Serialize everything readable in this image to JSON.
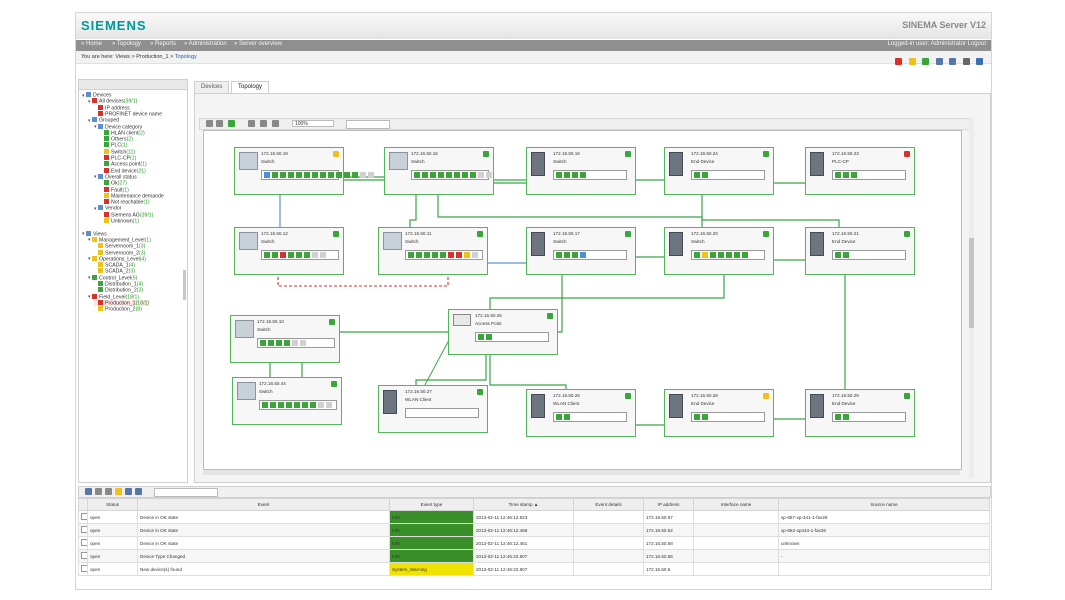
{
  "header": {
    "logo": "SIEMENS",
    "product": "SINEMA Server V12"
  },
  "nav": {
    "items": [
      "» Home",
      "» Topology",
      "» Reports",
      "» Administration",
      "» Server overview"
    ],
    "login": "Logged-in user: Administrator  Logout"
  },
  "breadcrumb": {
    "prefix": "You are here:  Views > Production_1 > ",
    "current": "Topology"
  },
  "colors": {
    "ok": "#3aa63a",
    "fault": "#d9302c",
    "warn": "#efc21b",
    "unknown": "#aaaaaa",
    "link": "#3ca34a"
  },
  "tree": [
    {
      "label": "Devices",
      "count": "",
      "level": 0,
      "icon": "folder",
      "toggle": "▾"
    },
    {
      "label": "All devices",
      "count": "(39/1)",
      "level": 1,
      "icon": "fault",
      "toggle": "▾"
    },
    {
      "label": "IP address",
      "count": "",
      "level": 2,
      "icon": "fault",
      "toggle": ""
    },
    {
      "label": "PROFINET device name",
      "count": "",
      "level": 2,
      "icon": "fault",
      "toggle": ""
    },
    {
      "label": "Grouped",
      "count": "",
      "level": 1,
      "icon": "folder",
      "toggle": "▾"
    },
    {
      "label": "Device category",
      "count": "",
      "level": 2,
      "icon": "folder",
      "toggle": "▾"
    },
    {
      "label": "HLAN client",
      "count": "(2)",
      "level": 3,
      "icon": "ok",
      "toggle": ""
    },
    {
      "label": "Others",
      "count": "(2)",
      "level": 3,
      "icon": "ok",
      "toggle": ""
    },
    {
      "label": "PLC",
      "count": "(1)",
      "level": 3,
      "icon": "ok",
      "toggle": ""
    },
    {
      "label": "Switch",
      "count": "(11)",
      "level": 3,
      "icon": "warn",
      "toggle": ""
    },
    {
      "label": "PLC-CP",
      "count": "(1)",
      "level": 3,
      "icon": "fault",
      "toggle": ""
    },
    {
      "label": "Access point",
      "count": "(1)",
      "level": 3,
      "icon": "ok",
      "toggle": ""
    },
    {
      "label": "End device",
      "count": "(21)",
      "level": 3,
      "icon": "fault",
      "toggle": ""
    },
    {
      "label": "Overall status",
      "count": "",
      "level": 2,
      "icon": "folder",
      "toggle": "▾"
    },
    {
      "label": "Ok",
      "count": "(27)",
      "level": 3,
      "icon": "ok",
      "toggle": ""
    },
    {
      "label": "Fault",
      "count": "(1)",
      "level": 3,
      "icon": "fault",
      "toggle": ""
    },
    {
      "label": "Maintenance demande",
      "count": "",
      "level": 3,
      "icon": "warn",
      "toggle": ""
    },
    {
      "label": "Not reachable",
      "count": "(1)",
      "level": 3,
      "icon": "fault",
      "toggle": ""
    },
    {
      "label": "Vendor",
      "count": "",
      "level": 2,
      "icon": "folder",
      "toggle": "▾"
    },
    {
      "label": "Siemens AG",
      "count": "(39/1)",
      "level": 3,
      "icon": "fault",
      "toggle": ""
    },
    {
      "label": "Unknown",
      "count": "(1)",
      "level": 3,
      "icon": "warn",
      "toggle": ""
    },
    {
      "label": "",
      "count": "",
      "level": 0,
      "icon": "none",
      "toggle": ""
    },
    {
      "label": "Views",
      "count": "",
      "level": 0,
      "icon": "folder",
      "toggle": "▾"
    },
    {
      "label": "Management_Level",
      "count": "(1)",
      "level": 1,
      "icon": "warn",
      "toggle": "▾"
    },
    {
      "label": "Servernoom_1",
      "count": "(3)",
      "level": 2,
      "icon": "warn",
      "toggle": ""
    },
    {
      "label": "Servernoom_2",
      "count": "(3)",
      "level": 2,
      "icon": "warn",
      "toggle": ""
    },
    {
      "label": "Operations_Level",
      "count": "(4)",
      "level": 1,
      "icon": "warn",
      "toggle": "▾"
    },
    {
      "label": "SCADA_1",
      "count": "(4)",
      "level": 2,
      "icon": "warn",
      "toggle": ""
    },
    {
      "label": "SCADA_2",
      "count": "(3)",
      "level": 2,
      "icon": "warn",
      "toggle": ""
    },
    {
      "label": "Control_Level",
      "count": "(5)",
      "level": 1,
      "icon": "ok",
      "toggle": "▾"
    },
    {
      "label": "Distribution_1",
      "count": "(4)",
      "level": 2,
      "icon": "ok",
      "toggle": ""
    },
    {
      "label": "Distribution_2",
      "count": "(3)",
      "level": 2,
      "icon": "ok",
      "toggle": ""
    },
    {
      "label": "Field_Level",
      "count": "(18/1)",
      "level": 1,
      "icon": "fault",
      "toggle": "▾"
    },
    {
      "label": "Production_1",
      "count": "(18/1)",
      "level": 2,
      "icon": "fault",
      "toggle": "",
      "selected": true
    },
    {
      "label": "Production_2",
      "count": "(8)",
      "level": 2,
      "icon": "warn",
      "toggle": ""
    }
  ],
  "tabs": [
    "Devices",
    "Topology"
  ],
  "toolbar": {
    "zoom": "100%"
  },
  "nodes": [
    {
      "id": "n19",
      "ip": "172.16.50.19",
      "type": "Switch",
      "status": "warn"
    },
    {
      "id": "n15",
      "ip": "172.16.50.15",
      "type": "Switch",
      "status": "ok"
    },
    {
      "id": "n16",
      "ip": "172.16.50.16",
      "type": "Switch",
      "status": "ok"
    },
    {
      "id": "n24",
      "ip": "172.16.50.24",
      "type": "End Device",
      "status": "ok"
    },
    {
      "id": "n23",
      "ip": "172.16.50.23",
      "type": "PLC-CP",
      "status": "fault"
    },
    {
      "id": "n12",
      "ip": "172.16.50.12",
      "type": "Switch",
      "status": "ok"
    },
    {
      "id": "n11",
      "ip": "172.16.50.11",
      "type": "Switch",
      "status": "ok"
    },
    {
      "id": "n17",
      "ip": "172.16.50.17",
      "type": "Switch",
      "status": "ok"
    },
    {
      "id": "n20",
      "ip": "172.16.50.20",
      "type": "Switch",
      "status": "ok"
    },
    {
      "id": "n21",
      "ip": "172.16.50.21",
      "type": "End Device",
      "status": "ok"
    },
    {
      "id": "n10",
      "ip": "172.16.50.10",
      "type": "Switch",
      "status": "ok"
    },
    {
      "id": "n25",
      "ip": "172.16.50.25",
      "type": "Access Point",
      "status": "ok"
    },
    {
      "id": "n44",
      "ip": "172.16.50.44",
      "type": "Switch",
      "status": "ok"
    },
    {
      "id": "n27",
      "ip": "172.16.50.27",
      "type": "WLAN Client",
      "status": "ok"
    },
    {
      "id": "n26",
      "ip": "172.16.50.26",
      "type": "WLAN Client",
      "status": "ok"
    },
    {
      "id": "n28",
      "ip": "172.16.50.28",
      "type": "End Device",
      "status": "warn"
    },
    {
      "id": "n29",
      "ip": "172.16.50.29",
      "type": "End Device",
      "status": "ok"
    }
  ],
  "events": {
    "columns": [
      "",
      "Status",
      "Event",
      "Event type",
      "Time stamp ▲",
      "Event details",
      "IP address",
      "Interface name",
      "Source name"
    ],
    "rows": [
      {
        "status": "open",
        "event": "Device in OK state",
        "event_type": "Info",
        "type_color": "#3a8f2a",
        "time": "2013-02-11 12:46:12.823",
        "details": "",
        "ip": "172.16.50.57",
        "iface": "",
        "source": "xp-657-xp-441-1-fax26"
      },
      {
        "status": "open",
        "event": "Device in OK state",
        "event_type": "Info",
        "type_color": "#3a8f2a",
        "time": "2013-02-11 12:46:12.468",
        "details": "",
        "ip": "172.16.50.52",
        "iface": "",
        "source": "xp-652-xp443-1-fax26"
      },
      {
        "status": "open",
        "event": "Device in OK state",
        "event_type": "Info",
        "type_color": "#3a8f2a",
        "time": "2013-02-11 12:46:12.451",
        "details": "",
        "ip": "172.16.50.58",
        "iface": "",
        "source": "unknown"
      },
      {
        "status": "open",
        "event": "Device Type Changed",
        "event_type": "Info",
        "type_color": "#3a8f2a",
        "time": "2013-02-11 12:46:22.807",
        "details": "",
        "ip": "172.16.50.55",
        "iface": "",
        "source": "-"
      },
      {
        "status": "open",
        "event": "New device(s) found",
        "event_type": "System_Warning",
        "type_color": "#f1e300",
        "time": "2013-02-11 12:46:22.807",
        "details": "",
        "ip": "172.16.50.5",
        "iface": "",
        "source": ""
      }
    ]
  }
}
